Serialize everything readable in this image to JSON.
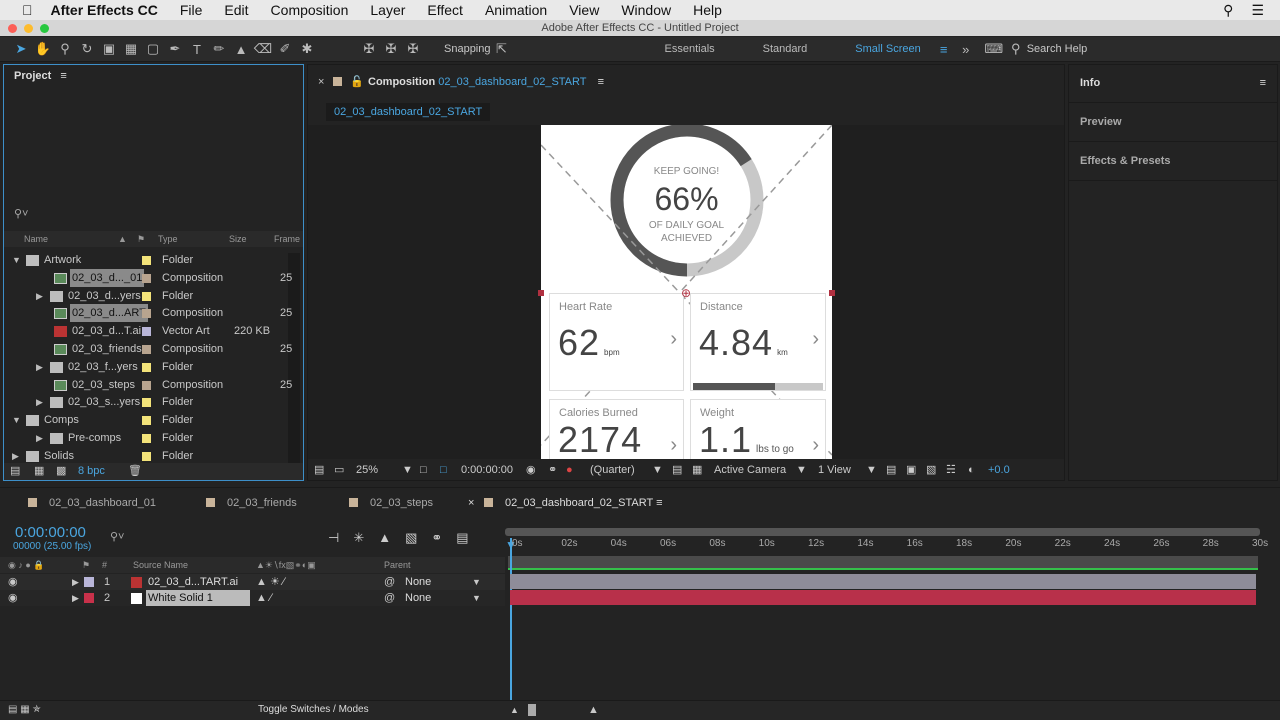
{
  "menubar": {
    "app": "After Effects CC",
    "items": [
      "File",
      "Edit",
      "Composition",
      "Layer",
      "Effect",
      "Animation",
      "View",
      "Window",
      "Help"
    ]
  },
  "title": "Adobe After Effects CC - Untitled Project",
  "toolbar": {
    "snapping": "Snapping",
    "workspaces": [
      "Essentials",
      "Standard",
      "Small Screen"
    ],
    "search_help": "Search Help"
  },
  "project": {
    "title": "Project",
    "columns": [
      "Name",
      "Type",
      "Size",
      "Frame"
    ],
    "bpc": "8 bpc",
    "items": [
      {
        "name": "Artwork",
        "type": "Folder",
        "size": "",
        "frame": "",
        "kind": "folder",
        "level": 0,
        "open": true,
        "swatch": "#f3e37a"
      },
      {
        "name": "02_03_d..._01",
        "type": "Composition",
        "size": "",
        "frame": "25",
        "kind": "comp",
        "level": 1,
        "sel": true,
        "swatch": "#b8a48f"
      },
      {
        "name": "02_03_d...yers",
        "type": "Folder",
        "size": "",
        "frame": "",
        "kind": "folder",
        "level": 1,
        "swatch": "#f3e37a"
      },
      {
        "name": "02_03_d...ART",
        "type": "Composition",
        "size": "",
        "frame": "25",
        "kind": "comp",
        "level": 1,
        "sel": true,
        "swatch": "#b8a48f"
      },
      {
        "name": "02_03_d...T.ai",
        "type": "Vector Art",
        "size": "220 KB",
        "frame": "",
        "kind": "ai",
        "level": 1,
        "swatch": "#b9b6d9"
      },
      {
        "name": "02_03_friends",
        "type": "Composition",
        "size": "",
        "frame": "25",
        "kind": "comp",
        "level": 1,
        "swatch": "#b8a48f"
      },
      {
        "name": "02_03_f...yers",
        "type": "Folder",
        "size": "",
        "frame": "",
        "kind": "folder",
        "level": 1,
        "swatch": "#f3e37a"
      },
      {
        "name": "02_03_steps",
        "type": "Composition",
        "size": "",
        "frame": "25",
        "kind": "comp",
        "level": 1,
        "swatch": "#b8a48f"
      },
      {
        "name": "02_03_s...yers",
        "type": "Folder",
        "size": "",
        "frame": "",
        "kind": "folder",
        "level": 1,
        "swatch": "#f3e37a"
      },
      {
        "name": "Comps",
        "type": "Folder",
        "size": "",
        "frame": "",
        "kind": "folder",
        "level": 0,
        "open": true,
        "swatch": "#f3e37a"
      },
      {
        "name": "Pre-comps",
        "type": "Folder",
        "size": "",
        "frame": "",
        "kind": "folder",
        "level": 1,
        "swatch": "#f3e37a"
      },
      {
        "name": "Solids",
        "type": "Folder",
        "size": "",
        "frame": "",
        "kind": "folder",
        "level": 0,
        "swatch": "#f3e37a"
      }
    ]
  },
  "composition": {
    "label": "Composition",
    "name": "02_03_dashboard_02_START",
    "tab": "02_03_dashboard_02_START",
    "canvas": {
      "goal_top": "KEEP GOING!",
      "goal_pct": "66%",
      "goal_sub1": "OF DAILY GOAL",
      "goal_sub2": "ACHIEVED",
      "goal_progress": 0.66,
      "cards": [
        {
          "label": "Heart Rate",
          "value": "62",
          "unit": "bpm"
        },
        {
          "label": "Distance",
          "value": "4.84",
          "unit": "km",
          "progress": 0.63
        },
        {
          "label": "Calories Burned",
          "value": "2174",
          "unit": ""
        },
        {
          "label": "Weight",
          "value": "1.1",
          "unit": "lbs to go"
        }
      ]
    },
    "footer": {
      "zoom": "25%",
      "time": "0:00:00:00",
      "resolution": "(Quarter)",
      "camera": "Active Camera",
      "views": "1 View",
      "exposure": "+0.0"
    }
  },
  "right_panels": [
    "Info",
    "Preview",
    "Effects & Presets"
  ],
  "timeline": {
    "tabs": [
      "02_03_dashboard_01",
      "02_03_friends",
      "02_03_steps",
      "02_03_dashboard_02_START"
    ],
    "timecode": "0:00:00:00",
    "fps": "00000 (25.00 fps)",
    "columns": {
      "source": "Source Name",
      "parent": "Parent",
      "num": "#"
    },
    "ticks": [
      "0s",
      "02s",
      "04s",
      "06s",
      "08s",
      "10s",
      "12s",
      "14s",
      "16s",
      "18s",
      "20s",
      "22s",
      "24s",
      "26s",
      "28s",
      "30s"
    ],
    "layers": [
      {
        "num": "1",
        "name": "02_03_d...TART.ai",
        "parent": "None",
        "label": "#b9b6d9",
        "bar": "#8e8c99"
      },
      {
        "num": "2",
        "name": "White Solid 1",
        "parent": "None",
        "label": "#c8314a",
        "bar": "#b8304a"
      }
    ],
    "toggle": "Toggle Switches / Modes"
  }
}
